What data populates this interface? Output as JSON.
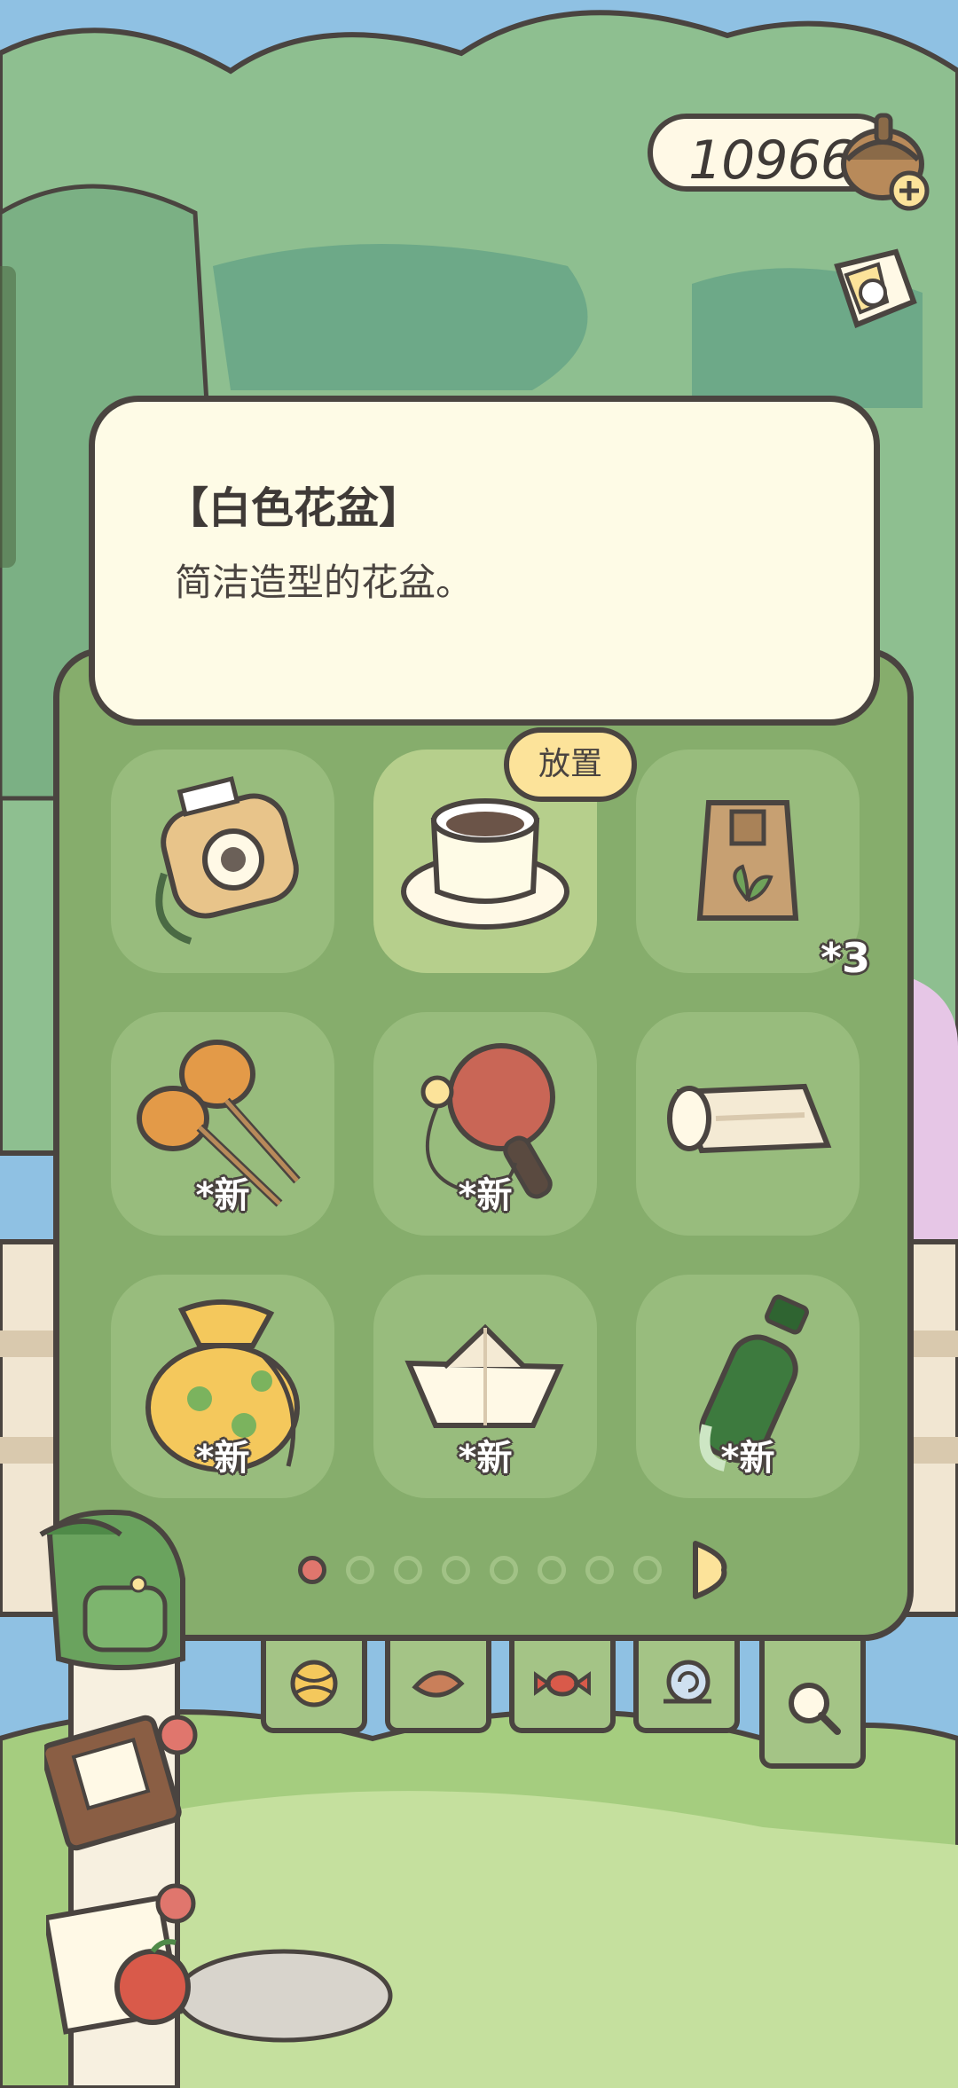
{
  "currency": {
    "amount": "10966",
    "icon": "acorn-clover-icon"
  },
  "item_detail": {
    "title": "【白色花盆】",
    "description": "简洁造型的花盆。"
  },
  "place_button": {
    "label": "放置"
  },
  "inventory": {
    "slots": [
      {
        "name": "instant-camera",
        "tag": "",
        "count": ""
      },
      {
        "name": "white-flowerpot",
        "tag": "",
        "count": "",
        "selected": true
      },
      {
        "name": "seed-pouch",
        "tag": "",
        "count": "*3"
      },
      {
        "name": "maracas",
        "tag": "*新",
        "count": ""
      },
      {
        "name": "ping-pong-paddle",
        "tag": "*新",
        "count": ""
      },
      {
        "name": "paper-roll",
        "tag": "",
        "count": ""
      },
      {
        "name": "clover-bag",
        "tag": "*新",
        "count": ""
      },
      {
        "name": "paper-boat",
        "tag": "*新",
        "count": ""
      },
      {
        "name": "green-bottle",
        "tag": "*新",
        "count": ""
      }
    ]
  },
  "pagination": {
    "pages": 8,
    "current": 1
  },
  "categories": [
    {
      "icon": "yarn-ball-icon"
    },
    {
      "icon": "leaf-food-icon"
    },
    {
      "icon": "candy-icon"
    },
    {
      "icon": "snail-shell-icon"
    },
    {
      "icon": "search-icon"
    }
  ],
  "side_buttons": [
    {
      "icon": "backpack-icon"
    },
    {
      "icon": "journal-icon"
    },
    {
      "icon": "mail-icon"
    },
    {
      "icon": "photo-album-icon"
    }
  ],
  "colors": {
    "panel": "#86ad6c",
    "card": "#fefbe6",
    "outline": "#4a4440",
    "button": "#fce39a",
    "active_dot": "#e0766d"
  }
}
